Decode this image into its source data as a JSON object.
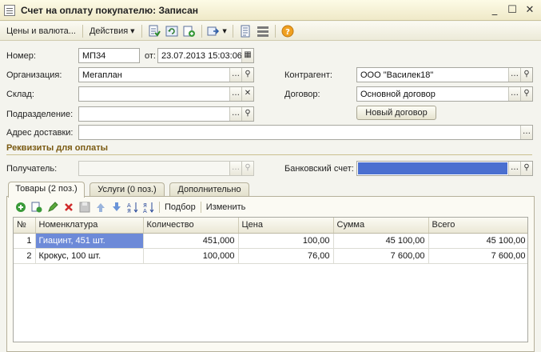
{
  "window": {
    "title": "Счет на оплату покупателю: Записан"
  },
  "toolbar": {
    "menu_prices": "Цены и валюта...",
    "menu_actions": "Действия"
  },
  "form": {
    "number_label": "Номер:",
    "number_value": "МП34",
    "date_label": "от:",
    "date_value": "23.07.2013 15:03:06",
    "org_label": "Организация:",
    "org_value": "Мегаплан",
    "warehouse_label": "Склад:",
    "warehouse_value": "",
    "division_label": "Подразделение:",
    "division_value": "",
    "address_label": "Адрес доставки:",
    "address_value": "",
    "counterparty_label": "Контрагент:",
    "counterparty_value": "ООО \"Василек18\"",
    "contract_label": "Договор:",
    "contract_value": "Основной договор",
    "new_contract_button": "Новый договор"
  },
  "payment": {
    "section_title": "Реквизиты для оплаты",
    "recipient_label": "Получатель:",
    "recipient_value": "",
    "bank_label": "Банковский счет:",
    "bank_value": ""
  },
  "tabs": [
    {
      "label": "Товары (2 поз.)"
    },
    {
      "label": "Услуги (0 поз.)"
    },
    {
      "label": "Дополнительно"
    }
  ],
  "table_toolbar": {
    "select_label": "Подбор",
    "edit_label": "Изменить"
  },
  "table": {
    "headers": [
      "№",
      "Номенклатура",
      "Количество",
      "Цена",
      "Сумма",
      "Всего"
    ],
    "rows": [
      [
        "1",
        "Гиацинт, 451 шт.",
        "451,000",
        "100,00",
        "45 100,00",
        "45 100,00"
      ],
      [
        "2",
        "Крокус, 100 шт.",
        "100,000",
        "76,00",
        "7 600,00",
        "7 600,00"
      ]
    ]
  },
  "colors": {
    "selection": "#6d8ad8",
    "section_title": "#7a5a12",
    "bank_field": "#4a6fd0"
  },
  "icons": [
    "app-icon",
    "minimize-icon",
    "maximize-icon",
    "close-icon",
    "help-icon"
  ]
}
